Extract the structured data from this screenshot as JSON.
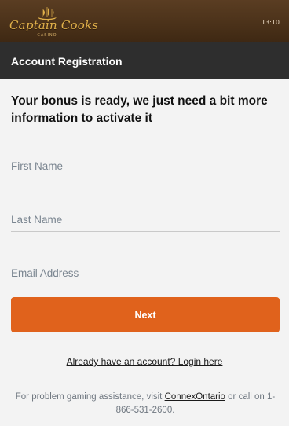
{
  "header": {
    "logo_text": "Captain Cooks",
    "logo_sub": "CASINO",
    "time": "13:10"
  },
  "page": {
    "title": "Account Registration",
    "intro": "Your bonus is ready, we just need a bit more information to activate it"
  },
  "form": {
    "first_name_placeholder": "First Name",
    "last_name_placeholder": "Last Name",
    "email_placeholder": "Email Address",
    "next_label": "Next"
  },
  "links": {
    "login": "Already have an account? Login here"
  },
  "footer": {
    "prefix": "For problem gaming assistance, visit",
    "link": "ConnexOntario",
    "suffix": "or call on 1-866-531-2600."
  },
  "colors": {
    "brand_orange": "#e0621c",
    "header_dark": "#2e2e2e",
    "logo_gold": "#e0b04a"
  }
}
